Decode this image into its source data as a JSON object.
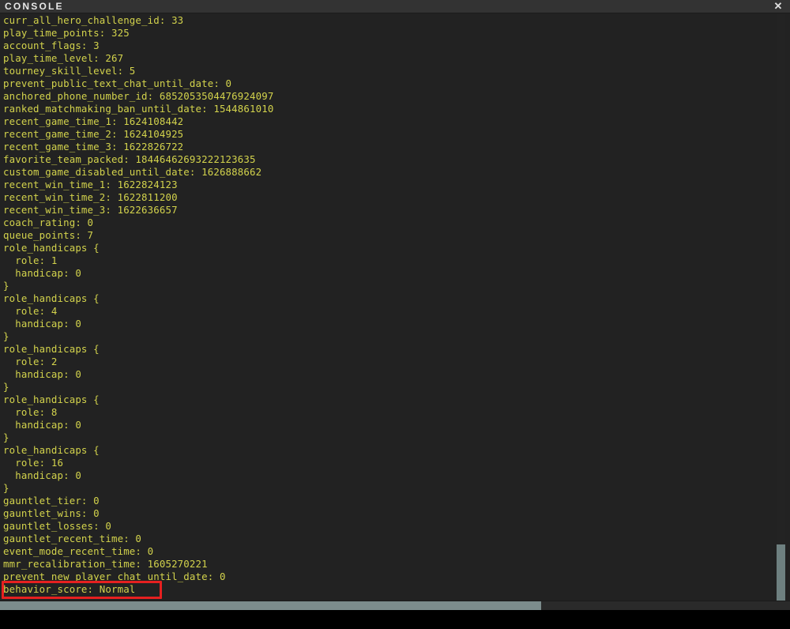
{
  "window": {
    "title": "CONSOLE",
    "close_icon": "close-icon",
    "close_label": "✕",
    "background_color": "#222222",
    "titlebar_color": "#333333",
    "text_color": "#d3d34c"
  },
  "annotation": {
    "type": "rectangle-highlight",
    "color": "#e62020",
    "target_line": "behavior_score: Normal"
  },
  "scrollbars": {
    "horizontal": {
      "thumb_color": "#7c8c8c",
      "track_color": "#2a2a2a"
    },
    "vertical": {
      "thumb_color": "#6e8080",
      "track_color": "#232323"
    }
  },
  "console": {
    "lines": [
      "curr_all_hero_challenge_id: 33",
      "play_time_points: 325",
      "account_flags: 3",
      "play_time_level: 267",
      "tourney_skill_level: 5",
      "prevent_public_text_chat_until_date: 0",
      "anchored_phone_number_id: 6852053504476924097",
      "ranked_matchmaking_ban_until_date: 1544861010",
      "recent_game_time_1: 1624108442",
      "recent_game_time_2: 1624104925",
      "recent_game_time_3: 1622826722",
      "favorite_team_packed: 18446462693222123635",
      "custom_game_disabled_until_date: 1626888662",
      "recent_win_time_1: 1622824123",
      "recent_win_time_2: 1622811200",
      "recent_win_time_3: 1622636657",
      "coach_rating: 0",
      "queue_points: 7",
      "role_handicaps {",
      "  role: 1",
      "  handicap: 0",
      "}",
      "role_handicaps {",
      "  role: 4",
      "  handicap: 0",
      "}",
      "role_handicaps {",
      "  role: 2",
      "  handicap: 0",
      "}",
      "role_handicaps {",
      "  role: 8",
      "  handicap: 0",
      "}",
      "role_handicaps {",
      "  role: 16",
      "  handicap: 0",
      "}",
      "gauntlet_tier: 0",
      "gauntlet_wins: 0",
      "gauntlet_losses: 0",
      "gauntlet_recent_time: 0",
      "event_mode_recent_time: 0",
      "mmr_recalibration_time: 1605270221",
      "prevent_new_player_chat_until_date: 0",
      "behavior_score: Normal"
    ]
  }
}
